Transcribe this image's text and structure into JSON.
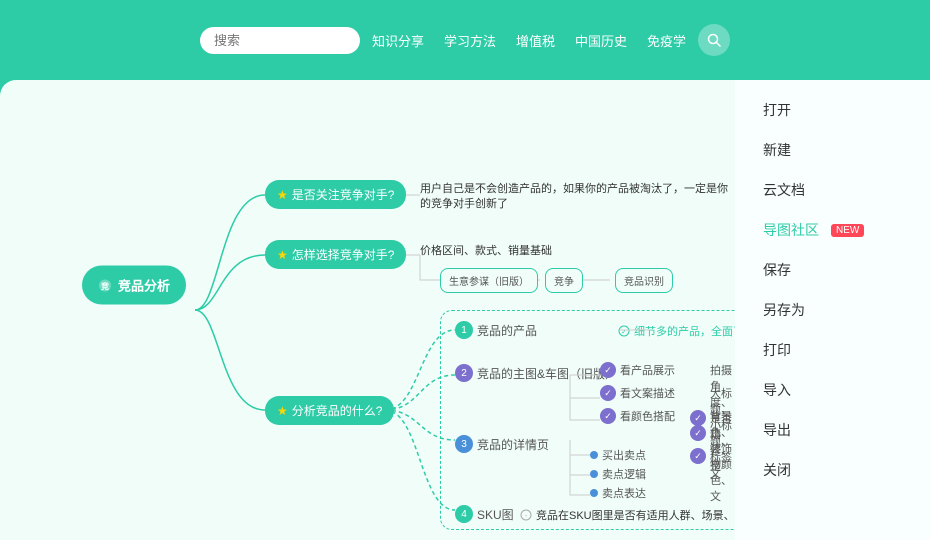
{
  "topbar": {
    "search_placeholder": "搜索",
    "nav_items": [
      "知识分享",
      "学习方法",
      "增值税",
      "中国历史",
      "免疫学"
    ]
  },
  "sidebar": {
    "items": [
      {
        "label": "打开",
        "active": false
      },
      {
        "label": "新建",
        "active": false
      },
      {
        "label": "云文档",
        "active": false
      },
      {
        "label": "导图社区",
        "active": true,
        "badge": "NEW"
      },
      {
        "label": "保存",
        "active": false
      },
      {
        "label": "另存为",
        "active": false
      },
      {
        "label": "打印",
        "active": false
      },
      {
        "label": "导入",
        "active": false
      },
      {
        "label": "导出",
        "active": false
      },
      {
        "label": "关闭",
        "active": false
      }
    ]
  },
  "mindmap": {
    "center_node": "竞品分析",
    "branches": [
      {
        "label": "是否关注竞争对手?",
        "y_pct": 22
      },
      {
        "label": "怎样选择竞争对手?",
        "y_pct": 38
      },
      {
        "label": "分析竞品的什么?",
        "y_pct": 72
      }
    ],
    "right_content": {
      "branch1_text": "用户自己是不会创造产品的，如果你的产品被淘汰了，一定是你的竞争对手创新了",
      "branch2_texts": [
        "价格区间、款式、销量基础",
        "生意参谋（旧版）",
        "竞争",
        "竞品识别"
      ],
      "sub_nodes": [
        {
          "num": "1",
          "label": "竞品的产品",
          "detail": "细节多的产品，全面了解"
        },
        {
          "num": "2",
          "label": "竞品的主图&车图（旧版）"
        },
        {
          "num": "3",
          "label": "竞品的详情页"
        },
        {
          "num": "4",
          "label": "SKU图",
          "detail": "竞品在SKU图里是否有适用人群、场景、规格参数的标注，我们"
        }
      ],
      "check_items": [
        "看产品展示",
        "拍摄角度、是否精修、是",
        "看文案描述",
        "大标题、小标题、标签文",
        "看颜色搭配",
        "背景色、装饰物颜色、文"
      ],
      "dot_items": [
        "买出卖点",
        "卖点逻辑",
        "卖点表达"
      ]
    }
  }
}
